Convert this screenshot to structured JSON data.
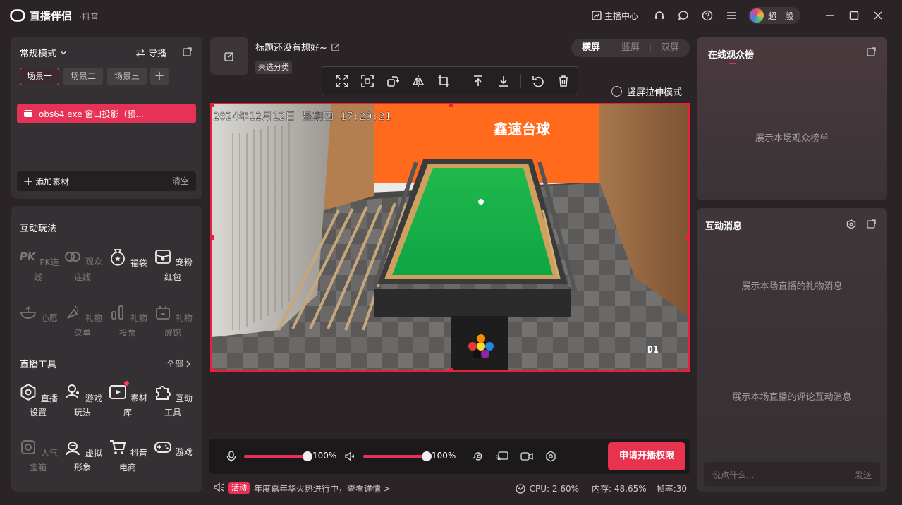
{
  "app": {
    "name": "直播伴侣",
    "sub": "·抖音"
  },
  "titlebar": {
    "studio": "主播中心",
    "username": "超一般"
  },
  "scenes": {
    "mode": "常规模式",
    "guide": "导播",
    "tabs": [
      "场景一",
      "场景二",
      "场景三"
    ],
    "source": "obs64.exe 窗口投影（预...",
    "add_source": "添加素材",
    "clear": "清空"
  },
  "interaction": {
    "title": "互动玩法",
    "items": [
      {
        "label": "PK连线",
        "icon": "pk-icon"
      },
      {
        "label": "观众连线",
        "icon": "audience-link-icon"
      },
      {
        "label": "福袋",
        "icon": "lucky-bag-icon"
      },
      {
        "label": "宠粉红包",
        "icon": "red-packet-icon"
      },
      {
        "label": "心愿",
        "icon": "wish-icon"
      },
      {
        "label": "礼物菜单",
        "icon": "gift-menu-icon"
      },
      {
        "label": "礼物投票",
        "icon": "gift-vote-icon"
      },
      {
        "label": "礼物展馆",
        "icon": "gift-hall-icon"
      }
    ]
  },
  "tools": {
    "title": "直播工具",
    "all": "全部",
    "items": [
      {
        "label": "直播设置",
        "icon": "live-settings-icon"
      },
      {
        "label": "游戏玩法",
        "icon": "game-play-icon"
      },
      {
        "label": "素材库",
        "icon": "material-library-icon"
      },
      {
        "label": "互动工具",
        "icon": "puzzle-icon"
      },
      {
        "label": "人气宝箱",
        "icon": "treasure-box-icon"
      },
      {
        "label": "虚拟形象",
        "icon": "avatar-icon"
      },
      {
        "label": "抖音电商",
        "icon": "cart-icon"
      },
      {
        "label": "游戏",
        "icon": "gamepad-icon"
      }
    ]
  },
  "stream": {
    "title": "标题还没有想好~",
    "category": "未选分类"
  },
  "orientation": {
    "options": [
      "横屏",
      "竖屏",
      "双屏"
    ],
    "selected": "横屏"
  },
  "stretch_mode": "竖屏拉伸模式",
  "preview": {
    "timestamp": "2024年12月12日  星期四  17:29:21",
    "sign": "鑫速台球",
    "tag": "D1"
  },
  "controls": {
    "mic_level": 100,
    "mic_pct": "100%",
    "speaker_level": 100,
    "speaker_pct": "100%",
    "apply": "申请开播权限"
  },
  "status": {
    "badge": "活动",
    "activity": "年度嘉年华火热进行中，查看详情 >",
    "cpu": "CPU: 2.60%",
    "mem": "内存: 48.65%",
    "fps": "帧率:30"
  },
  "audience": {
    "title": "在线观众榜",
    "empty": "展示本场观众榜单"
  },
  "messages": {
    "title": "互动消息",
    "gift_empty": "展示本场直播的礼物消息",
    "comment_empty": "展示本场直播的评论互动消息",
    "placeholder": "说点什么...",
    "send": "发送"
  },
  "colors": {
    "accent": "#e63256",
    "bg": "#2a2426",
    "panel": "#353033"
  }
}
